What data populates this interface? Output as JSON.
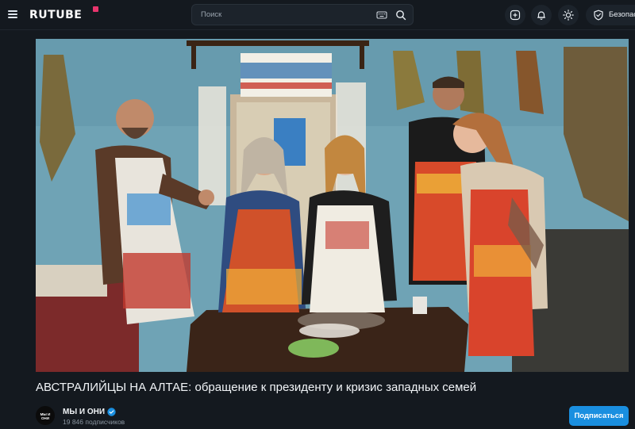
{
  "header": {
    "logo": "RUTUBE",
    "search": {
      "placeholder": "Поиск",
      "value": ""
    },
    "safety_label": "Безопасн"
  },
  "video": {
    "title": "АВСТРАЛИЙЦЫ НА АЛТАЕ: обращение к президенту и кризис западных семей"
  },
  "channel": {
    "name": "МЫ И ОНИ",
    "subscribers": "19 846 подписчиков",
    "avatar_text": "МЫ И ОНИ",
    "verified": true
  },
  "actions": {
    "subscribe_label": "Подписаться"
  },
  "colors": {
    "accent": "#1a8fe0",
    "background": "#14191f",
    "logo_mark": "#e8356d"
  }
}
